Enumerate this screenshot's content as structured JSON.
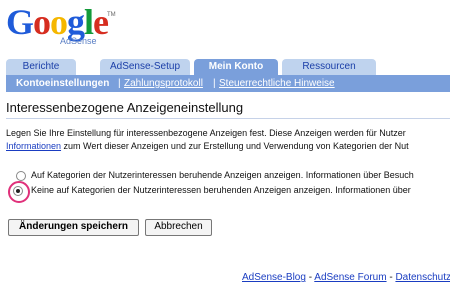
{
  "logo": {
    "letters": [
      "G",
      "o",
      "o",
      "g",
      "l",
      "e"
    ],
    "letter_colors": [
      "#1f5bd9",
      "#d62d20",
      "#f5b700",
      "#1f5bd9",
      "#139a3a",
      "#d62d20"
    ],
    "subtitle": "AdSense",
    "tm": "TM"
  },
  "tabs": [
    {
      "label": "Berichte",
      "active": false
    },
    {
      "label": "AdSense-Setup",
      "active": false
    },
    {
      "label": "Mein Konto",
      "active": true
    },
    {
      "label": "Ressourcen",
      "active": false
    }
  ],
  "subnav": {
    "items": [
      "Kontoeinstellungen",
      "Zahlungsprotokoll",
      "Steuerrechtliche Hinweise"
    ],
    "separator": "|"
  },
  "page_title": "Interessenbezogene Anzeigeneinstellung",
  "description": {
    "line1": "Legen Sie Ihre Einstellung für interessenbezogene Anzeigen fest. Diese Anzeigen werden für Nutzer",
    "link": "Informationen",
    "line2_rest": " zum Wert dieser Anzeigen und zur Erstellung und Verwendung von Kategorien der Nut"
  },
  "options": [
    {
      "label": "Auf Kategorien der Nutzerinteressen beruhende Anzeigen anzeigen. Informationen über Besuch",
      "checked": false
    },
    {
      "label": "Keine auf Kategorien der Nutzerinteressen beruhenden Anzeigen anzeigen. Informationen über",
      "checked": true
    }
  ],
  "buttons": {
    "save": "Änderungen speichern",
    "cancel": "Abbrechen"
  },
  "footer": {
    "links": [
      "AdSense-Blog",
      "AdSense Forum",
      "Datenschutz"
    ],
    "separator": " - "
  },
  "colors": {
    "tab_inactive": "#bfd3ee",
    "tab_active": "#7a9fdb",
    "link": "#1a3dc1",
    "highlight": "#e0307a"
  }
}
